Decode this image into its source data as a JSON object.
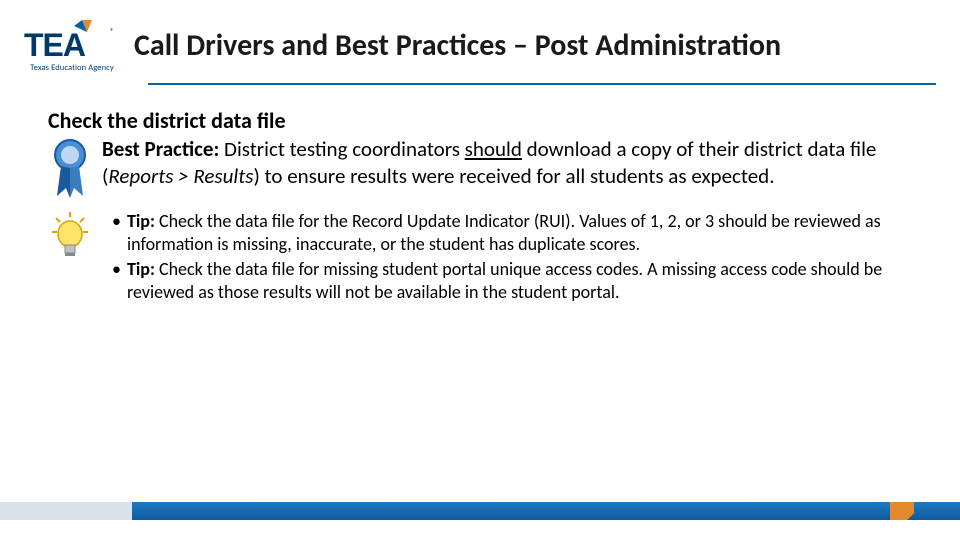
{
  "header": {
    "logo_text": "TEA",
    "logo_subtext": "Texas Education Agency",
    "title": "Call Drivers and Best Practices – Post Administration"
  },
  "content": {
    "section_heading": "Check the district data file",
    "best_practice": {
      "label": "Best Practice:  ",
      "part1": "District testing coordinators ",
      "underlined": "should",
      "part2": " download a copy of their district data file (",
      "italic": "Reports > Results",
      "part3": ") to ensure results were received for all students as expected."
    },
    "tips": [
      {
        "label": "Tip: ",
        "text": "Check the data file for the Record Update Indicator (RUI).  Values of 1, 2, or 3 should be reviewed as information is missing, inaccurate, or the student has duplicate scores."
      },
      {
        "label": "Tip: ",
        "text": "Check the data file for missing student portal unique access codes.  A missing access code should be reviewed as those results will not be available in the student portal."
      }
    ]
  },
  "icons": {
    "ribbon": "ribbon-icon",
    "lightbulb": "lightbulb-icon"
  }
}
